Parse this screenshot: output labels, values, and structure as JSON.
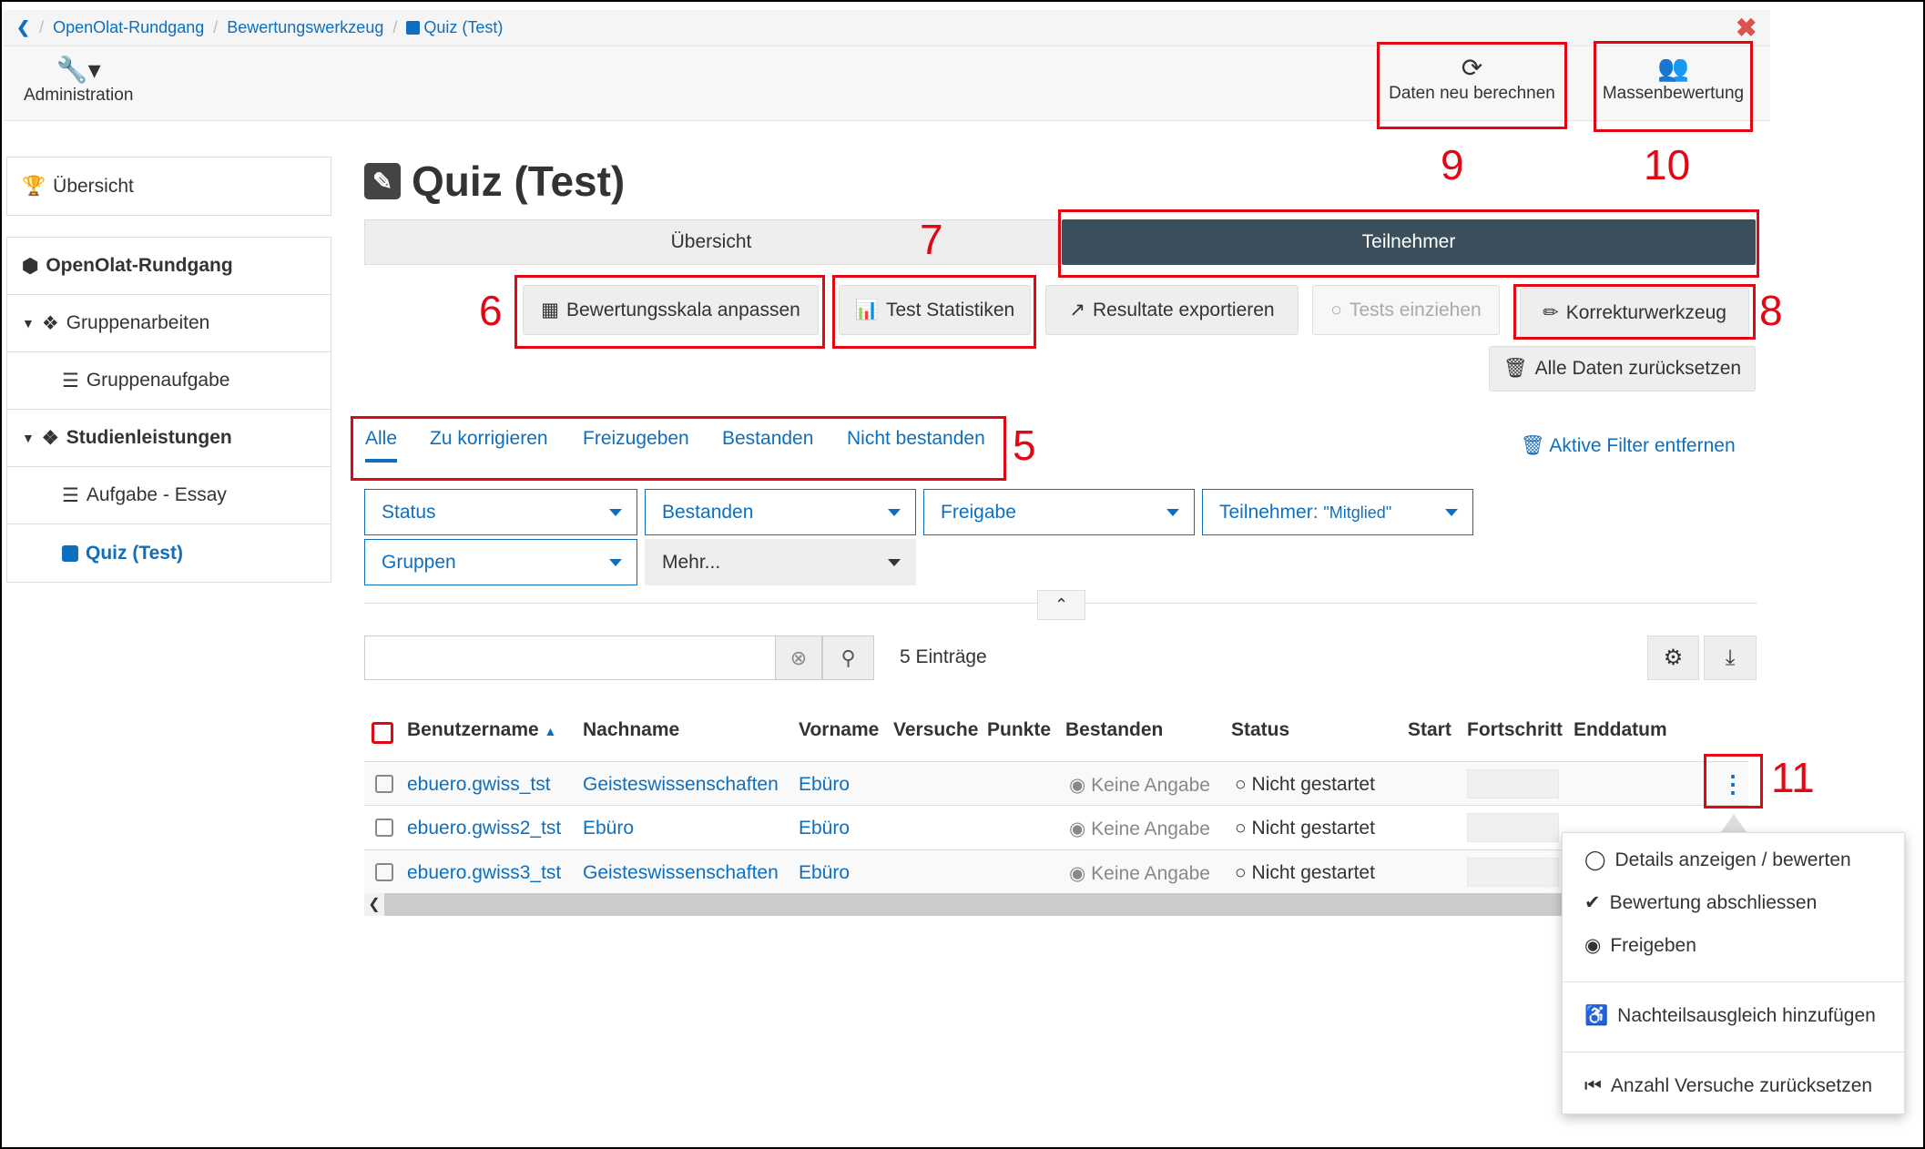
{
  "breadcrumb": {
    "items": [
      "OpenOlat-Rundgang",
      "Bewertungswerkzeug",
      "Quiz (Test)"
    ]
  },
  "toolbar": {
    "admin": "Administration",
    "recalc": "Daten neu berechnen",
    "mass": "Massenbewertung"
  },
  "sidebar": {
    "overview": "Übersicht",
    "items": [
      "OpenOlat-Rundgang",
      "Gruppenarbeiten",
      "Gruppenaufgabe",
      "Studienleistungen",
      "Aufgabe - Essay",
      "Quiz (Test)"
    ]
  },
  "title": "Quiz (Test)",
  "tabs": [
    "Übersicht",
    "Teilnehmer"
  ],
  "actions": {
    "scale": "Bewertungsskala anpassen",
    "stats": "Test Statistiken",
    "export": "Resultate exportieren",
    "collect": "Tests einziehen",
    "correct": "Korrekturwerkzeug",
    "reset": "Alle Daten zurücksetzen"
  },
  "filter_tabs": [
    "Alle",
    "Zu korrigieren",
    "Freizugeben",
    "Bestanden",
    "Nicht bestanden"
  ],
  "remove_filters": "Aktive Filter entfernen",
  "filters": {
    "status": "Status",
    "passed": "Bestanden",
    "release": "Freigabe",
    "participant_label": "Teilnehmer:",
    "participant_value": "\"Mitglied\"",
    "groups": "Gruppen",
    "more": "Mehr..."
  },
  "search": {
    "value": "",
    "count": "5 Einträge"
  },
  "table": {
    "headers": [
      "Benutzername",
      "Nachname",
      "Vorname",
      "Versuche",
      "Punkte",
      "Bestanden",
      "Status",
      "Start",
      "Fortschritt",
      "Enddatum"
    ],
    "rows": [
      {
        "user": "ebuero.gwiss_tst",
        "last": "Geisteswissenschaften",
        "first": "Ebüro",
        "passed": "Keine Angabe",
        "status": "Nicht gestartet"
      },
      {
        "user": "ebuero.gwiss2_tst",
        "last": "Ebüro",
        "first": "Ebüro",
        "passed": "Keine Angabe",
        "status": "Nicht gestartet"
      },
      {
        "user": "ebuero.gwiss3_tst",
        "last": "Geisteswissenschaften",
        "first": "Ebüro",
        "passed": "Keine Angabe",
        "status": "Nicht gestartet"
      }
    ]
  },
  "menu": [
    "Details anzeigen / bewerten",
    "Bewertung abschliessen",
    "Freigeben",
    "Nachteilsausgleich hinzufügen",
    "Anzahl Versuche zurücksetzen"
  ],
  "annotations": [
    "5",
    "6",
    "7",
    "8",
    "9",
    "10",
    "11"
  ],
  "colors": {
    "accent": "#0e6fbf",
    "active_tab": "#3a4f5b",
    "annotation": "#e30613"
  }
}
